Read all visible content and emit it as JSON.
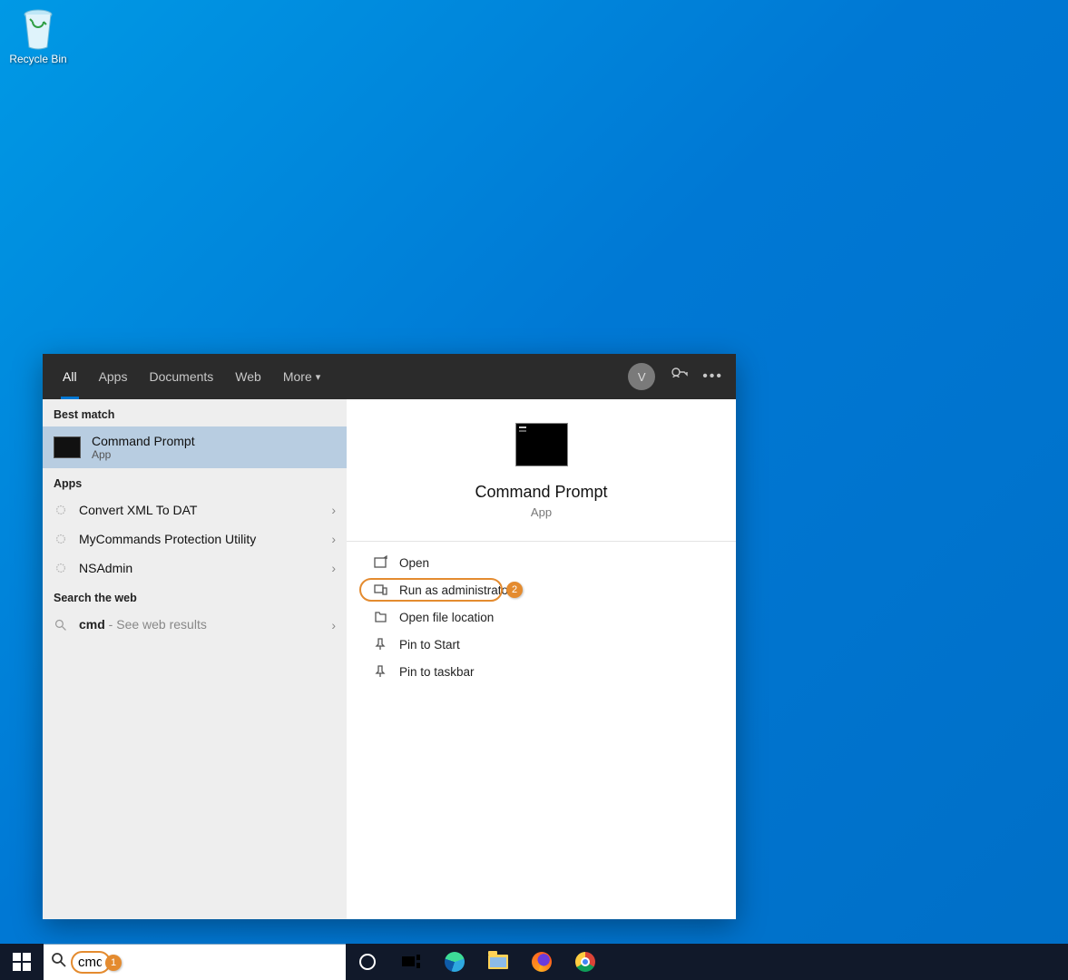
{
  "desktop": {
    "recycle_bin_label": "Recycle Bin"
  },
  "search": {
    "tabs": {
      "all": "All",
      "apps": "Apps",
      "documents": "Documents",
      "web": "Web",
      "more": "More"
    },
    "avatar_initial": "V",
    "best_match_label": "Best match",
    "apps_label": "Apps",
    "web_label": "Search the web",
    "best_match": {
      "title": "Command Prompt",
      "subtitle": "App"
    },
    "app_results": [
      {
        "title": "Convert XML To DAT"
      },
      {
        "title": "MyCommands Protection Utility"
      },
      {
        "title": "NSAdmin"
      }
    ],
    "web_result": {
      "query": "cmd",
      "hint": " - See web results"
    },
    "detail": {
      "title": "Command Prompt",
      "subtitle": "App",
      "actions": {
        "open": "Open",
        "run_admin": "Run as administrator",
        "open_loc": "Open file location",
        "pin_start": "Pin to Start",
        "pin_taskbar": "Pin to taskbar"
      }
    }
  },
  "callouts": {
    "search_badge": "1",
    "admin_badge": "2"
  },
  "taskbar": {
    "search_value": "cmd"
  }
}
